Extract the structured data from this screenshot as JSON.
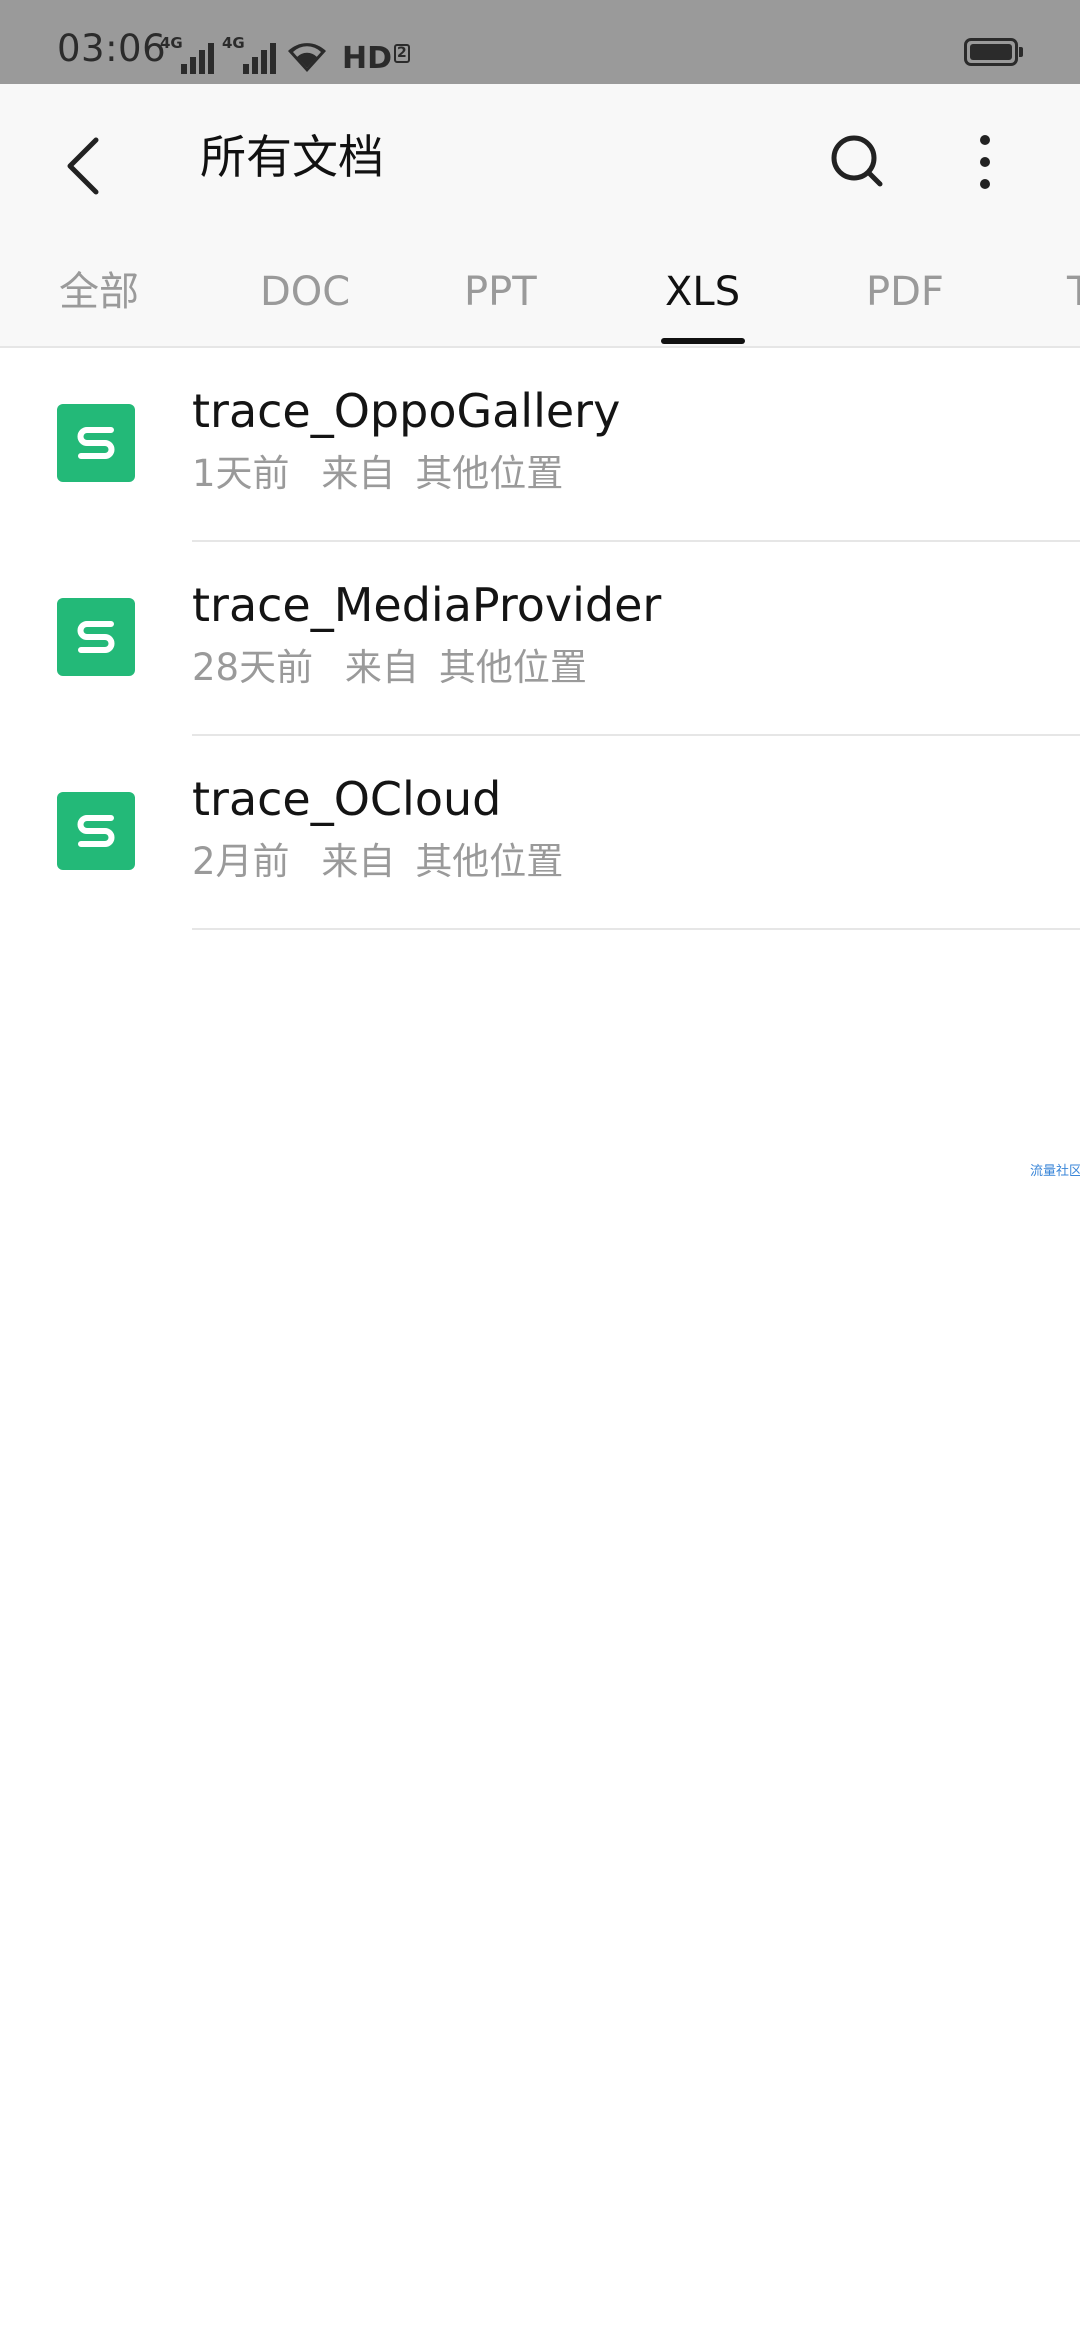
{
  "status_bar": {
    "time": "03:06",
    "signal_1_label": "4G",
    "signal_2_label": "4G",
    "hd_label": "HD",
    "hd_sub": "2",
    "icons": [
      "signal-icon",
      "signal-icon",
      "wifi-icon",
      "battery-icon"
    ]
  },
  "header": {
    "title": "所有文档",
    "back_icon": "chevron-left-icon",
    "search_icon": "search-icon",
    "more_icon": "more-vertical-icon"
  },
  "tabs": [
    {
      "label": "全部",
      "active": false
    },
    {
      "label": "DOC",
      "active": false
    },
    {
      "label": "PPT",
      "active": false
    },
    {
      "label": "XLS",
      "active": true
    },
    {
      "label": "PDF",
      "active": false
    },
    {
      "label": "T",
      "active": false
    }
  ],
  "files": [
    {
      "name": "trace_OppoGallery",
      "time": "1天前",
      "from_label": "来自",
      "location": "其他位置",
      "icon": "spreadsheet-icon"
    },
    {
      "name": "trace_MediaProvider",
      "time": "28天前",
      "from_label": "来自",
      "location": "其他位置",
      "icon": "spreadsheet-icon"
    },
    {
      "name": "trace_OCloud",
      "time": "2月前",
      "from_label": "来自",
      "location": "其他位置",
      "icon": "spreadsheet-icon"
    }
  ],
  "watermark": "流量社区",
  "colors": {
    "status_bar_bg": "#9a9a9a",
    "header_bg": "#f8f8f8",
    "accent_green": "#23b978",
    "active_text": "#111111",
    "muted_text": "#9a9a9a"
  }
}
